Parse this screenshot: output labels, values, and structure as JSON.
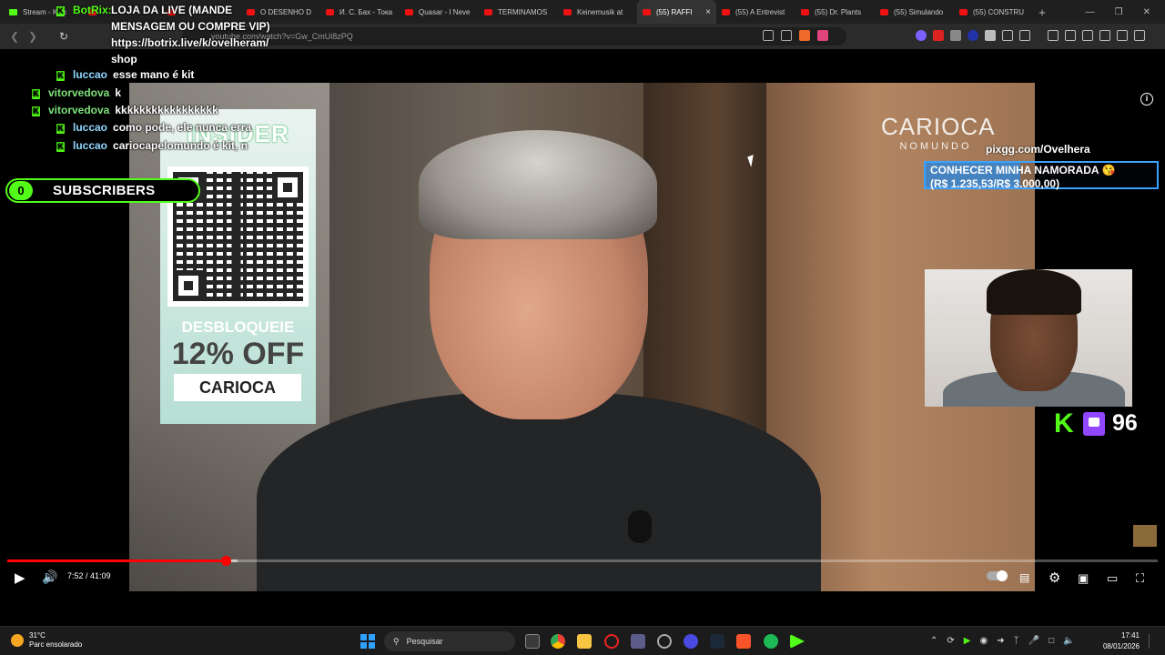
{
  "browser": {
    "tabs": [
      {
        "label": "Stream - Kick",
        "icon": "kick-icon",
        "active": false
      },
      {
        "label": "",
        "icon": "youtube-icon",
        "active": false
      },
      {
        "label": "",
        "icon": "youtube-icon",
        "active": false
      },
      {
        "label": "O DESENHO D",
        "icon": "youtube-icon",
        "active": false
      },
      {
        "label": "И. С. Бах - Тока",
        "icon": "youtube-icon",
        "active": false
      },
      {
        "label": "Quasar - I Neve",
        "icon": "youtube-icon",
        "active": false
      },
      {
        "label": "TERMINAMOS",
        "icon": "youtube-icon",
        "active": false
      },
      {
        "label": "Keinemusik at",
        "icon": "youtube-icon",
        "active": false
      },
      {
        "label": "(55) RAFFI",
        "icon": "youtube-icon",
        "active": true
      },
      {
        "label": "(55) A Entrevist",
        "icon": "youtube-icon",
        "active": false
      },
      {
        "label": "(55) Dr. Plants",
        "icon": "youtube-icon",
        "active": false
      },
      {
        "label": "(55) Simulando",
        "icon": "youtube-icon",
        "active": false
      },
      {
        "label": "(55) CONSTRU",
        "icon": "youtube-icon",
        "active": false
      }
    ],
    "new_tab": "+",
    "url": "youtube.com/watch?v=Gw_CmUi8zPQ"
  },
  "chat": {
    "botrix": {
      "user": "BotRix:",
      "message": "LOJA DA LIVE (MANDE MENSAGEM OU COMPRE VIP) https://botrix.live/k/ovelheram/ shop"
    },
    "messages": [
      {
        "user": "luccao",
        "text": "esse mano é kit",
        "color": "#8fd7ff"
      },
      {
        "user": "vitorvedova",
        "text": "k",
        "color": "#7ee17a"
      },
      {
        "user": "vitorvedova",
        "text": "kkkkkkkkkkkkkkkkk",
        "color": "#7ee17a"
      },
      {
        "user": "luccao",
        "text": "como pode, ele nunca erra",
        "color": "#8fd7ff"
      },
      {
        "user": "luccao",
        "text": "cariocapelomundo é kit, n",
        "color": "#8fd7ff"
      }
    ]
  },
  "subscribers": {
    "count": "0",
    "label": "SUBSCRIBERS"
  },
  "sponsor": {
    "brand": "INSIDER",
    "unlock": "DESBLOQUEIE",
    "discount": "12% OFF",
    "code": "CARIOCA"
  },
  "watermark": {
    "line1": "CARIOCA",
    "line2": "NOMUNDO"
  },
  "pix": {
    "url": "pixgg.com/Ovelhera",
    "goal_title": "CONHECER MINHA NAMORADA 😘",
    "goal_amount": "(R$ 1.235,53/R$ 3.000,00)",
    "goal_progress": 0.41
  },
  "viewers": {
    "count": "96"
  },
  "player": {
    "time": "7:52 / 41:09",
    "progress": 0.19,
    "buffered": 0.2
  },
  "taskbar": {
    "temperature": "31°C",
    "weather": "Parc ensolarado",
    "search_placeholder": "Pesquisar",
    "time": "17:41",
    "date": "08/01/2026"
  },
  "colors": {
    "kick_green": "#53fc18",
    "youtube_red": "#ff0000",
    "twitch_purple": "#9146ff"
  }
}
